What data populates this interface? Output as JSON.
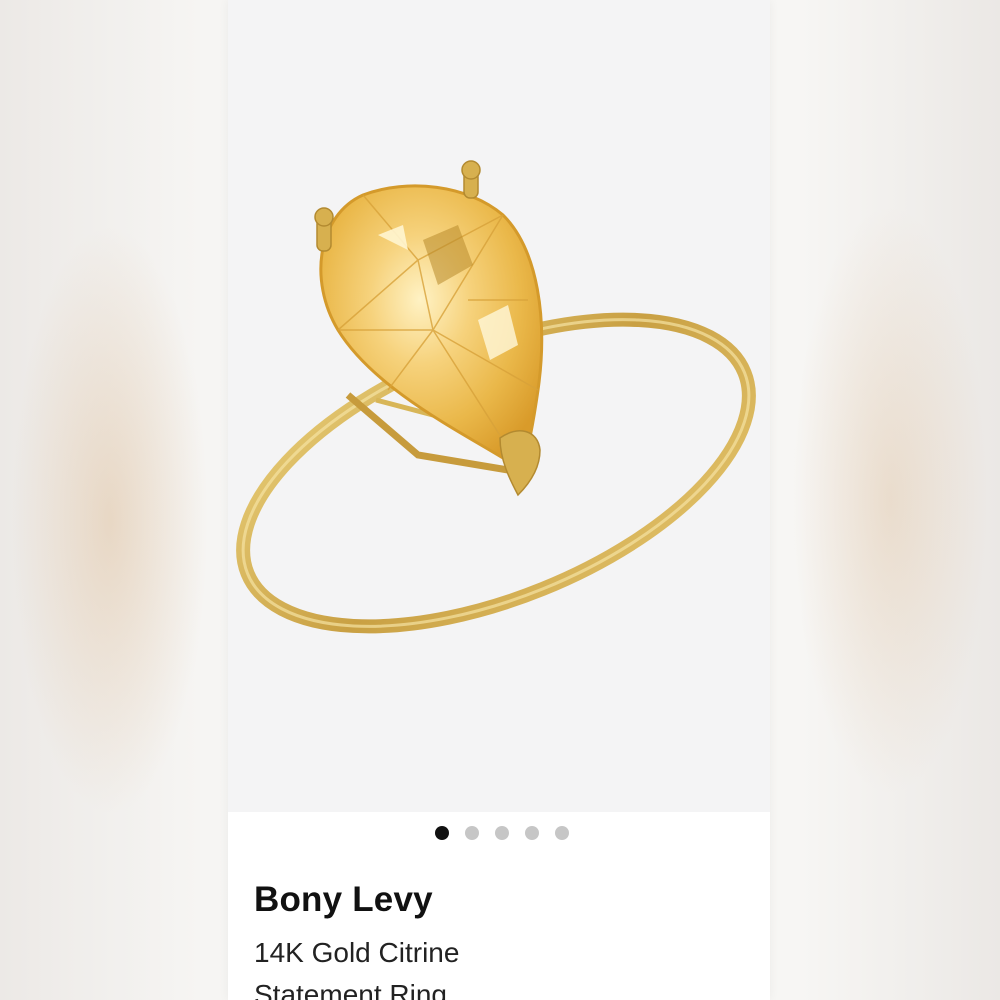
{
  "product": {
    "brand": "Bony Levy",
    "name_line1": "14K Gold Citrine",
    "name_line2": "Statement Ring",
    "image_alt": "pear-shaped citrine ring"
  },
  "carousel": {
    "total_images": 5,
    "active_index": 0
  },
  "colors": {
    "gold": "#d8b658",
    "citrine": "#f1c865",
    "active_dot": "#111111",
    "inactive_dot": "#c6c6c6"
  }
}
